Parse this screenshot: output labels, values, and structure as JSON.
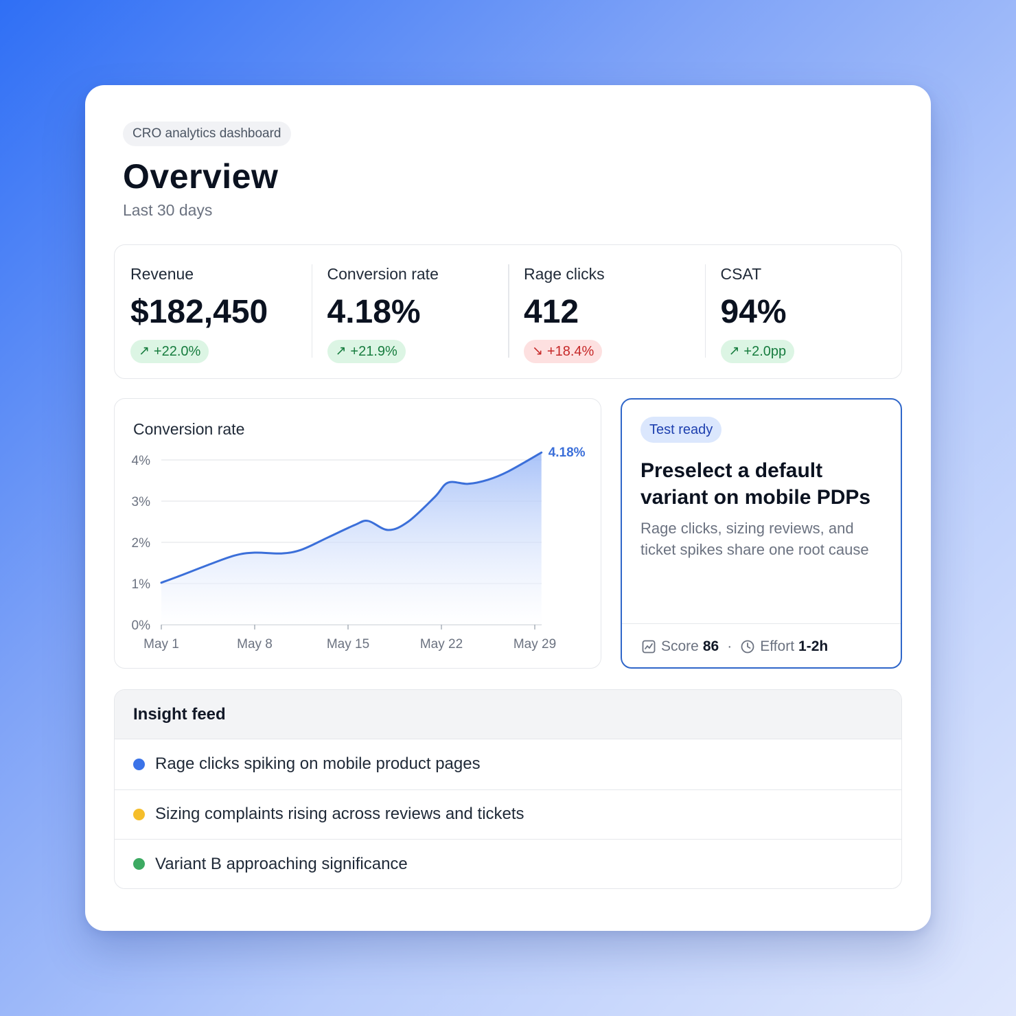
{
  "header": {
    "eyebrow": "CRO analytics dashboard",
    "title": "Overview",
    "subtitle": "Last 30 days"
  },
  "kpis": [
    {
      "label": "Revenue",
      "value": "$182,450",
      "delta": "+22.0%",
      "direction": "up",
      "good": true
    },
    {
      "label": "Conversion rate",
      "value": "4.18%",
      "delta": "+21.9%",
      "direction": "up",
      "good": true
    },
    {
      "label": "Rage clicks",
      "value": "412",
      "delta": "+18.4%",
      "direction": "down",
      "good": false
    },
    {
      "label": "CSAT",
      "value": "94%",
      "delta": "+2.0pp",
      "direction": "up",
      "good": true
    }
  ],
  "chart": {
    "title": "Conversion rate",
    "end_label": "4.18%"
  },
  "chart_data": {
    "type": "area",
    "title": "Conversion rate",
    "xlabel": "",
    "ylabel": "",
    "x_ticks": [
      "May 1",
      "May 8",
      "May 15",
      "May 22",
      "May 29"
    ],
    "y_ticks": [
      "0%",
      "1%",
      "2%",
      "3%",
      "4%"
    ],
    "ylim": [
      0,
      4
    ],
    "grid": true,
    "line_color": "#3b6fd9",
    "x": [
      1,
      3,
      5,
      7,
      9,
      11,
      13,
      15,
      17,
      19,
      21,
      23,
      25,
      27,
      29,
      30
    ],
    "values": [
      1.02,
      1.2,
      1.45,
      1.68,
      1.75,
      1.73,
      1.82,
      2.12,
      2.42,
      2.52,
      2.3,
      2.5,
      3.1,
      3.45,
      3.42,
      3.52,
      3.72,
      4.18
    ],
    "x_days": [
      1,
      2.5,
      4.5,
      6.5,
      8,
      10,
      11.5,
      13.5,
      15.5,
      16.5,
      18,
      19.5,
      21.5,
      22.5,
      24,
      25.5,
      27,
      29.5
    ],
    "end_value_label": "4.18%"
  },
  "suggestion": {
    "badge": "Test ready",
    "title": "Preselect a default variant on mobile PDPs",
    "description": "Rage clicks, sizing reviews, and ticket spikes share one root cause",
    "score_label": "Score",
    "score_value": "86",
    "separator": "·",
    "effort_label": "Effort",
    "effort_value": "1-2h"
  },
  "feed": {
    "title": "Insight feed",
    "items": [
      {
        "text": "Rage clicks spiking on mobile product pages",
        "color": "#3b73e8"
      },
      {
        "text": "Sizing complaints rising across reviews and tickets",
        "color": "#f5be2b"
      },
      {
        "text": "Variant B approaching significance",
        "color": "#3daa62"
      }
    ]
  },
  "colors": {
    "accent": "#2f66c9",
    "positive_bg": "#dcf5e4",
    "positive_fg": "#167c3e",
    "negative_bg": "#fde0e0",
    "negative_fg": "#c62828"
  },
  "icons": {
    "up": "arrow-up-right-icon",
    "down": "arrow-down-right-icon",
    "score": "chart-icon",
    "effort": "clock-icon"
  }
}
